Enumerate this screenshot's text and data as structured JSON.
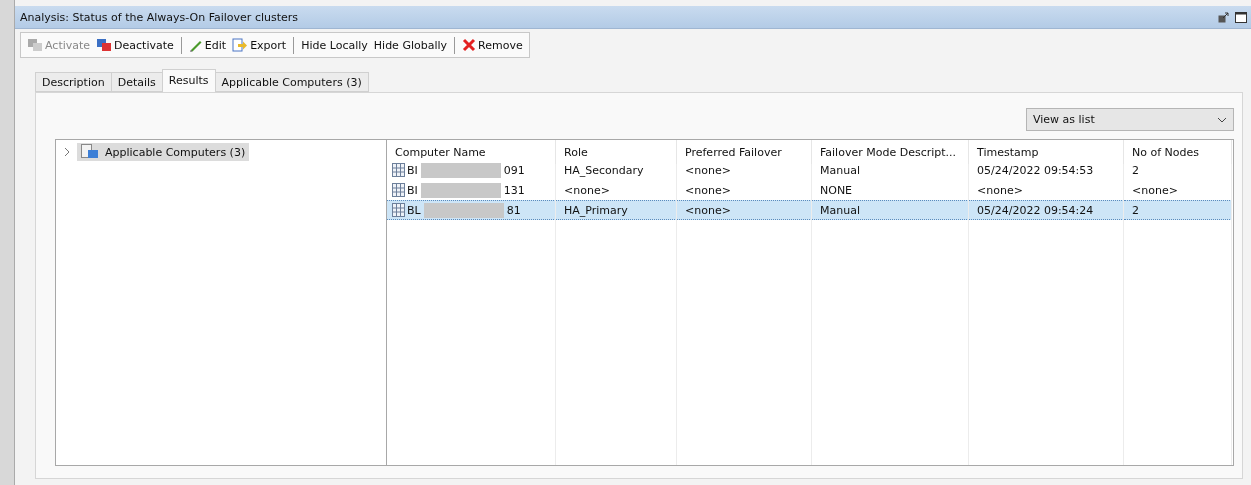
{
  "window": {
    "title": "Analysis: Status of the Always-On Failover clusters"
  },
  "toolbar": [
    [
      {
        "kind": "activate",
        "label": "Activate",
        "disabled": true
      },
      {
        "kind": "deactivate",
        "label": "Deactivate",
        "disabled": false
      }
    ],
    [
      {
        "kind": "edit",
        "label": "Edit",
        "disabled": false
      },
      {
        "kind": "export",
        "label": "Export",
        "disabled": false
      }
    ],
    [
      {
        "kind": "text",
        "label": "Hide Locally",
        "disabled": false
      },
      {
        "kind": "text",
        "label": "Hide Globally",
        "disabled": false
      }
    ],
    [
      {
        "kind": "remove",
        "label": "Remove",
        "disabled": false
      }
    ]
  ],
  "tabs": [
    {
      "label": "Description",
      "selected": false
    },
    {
      "label": "Details",
      "selected": false
    },
    {
      "label": "Results",
      "selected": true
    },
    {
      "label": "Applicable Computers (3)",
      "selected": false
    }
  ],
  "view_select": {
    "value": "View as list"
  },
  "tree": {
    "items": [
      {
        "label": "Applicable Computers (3)",
        "selected": true,
        "expanded": false
      }
    ]
  },
  "table": {
    "columns": [
      "Computer Name",
      "Role",
      "Preferred Failover",
      "Failover Mode Descript...",
      "Timestamp",
      "No of Nodes"
    ],
    "rows": [
      {
        "cells": [
          "BI",
          "HA_Secondary",
          "<none>",
          "Manual",
          "05/24/2022 09:54:53",
          "2"
        ],
        "name_end": "091",
        "selected": false
      },
      {
        "cells": [
          "BI",
          "<none>",
          "<none>",
          "NONE",
          "<none>",
          "<none>"
        ],
        "name_end": "131",
        "selected": false
      },
      {
        "cells": [
          "BL",
          "HA_Primary",
          "<none>",
          "Manual",
          "05/24/2022 09:54:24",
          "2"
        ],
        "name_end": "81",
        "selected": true
      }
    ]
  }
}
